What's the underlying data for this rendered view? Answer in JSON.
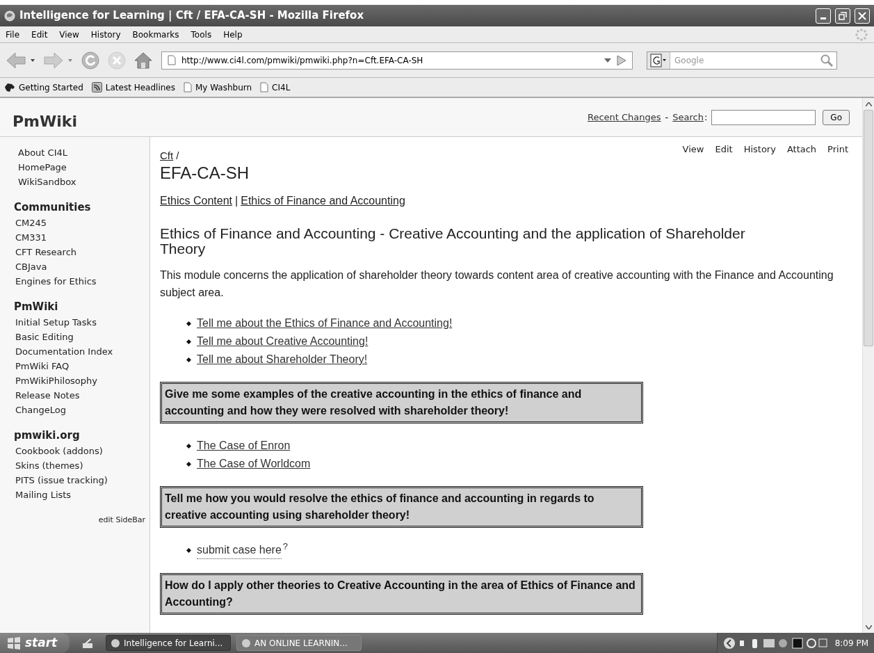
{
  "window": {
    "title": "Intelligence for Learning | Cft / EFA-CA-SH - Mozilla Firefox"
  },
  "menu": [
    "File",
    "Edit",
    "View",
    "History",
    "Bookmarks",
    "Tools",
    "Help"
  ],
  "address": {
    "value": "http://www.ci4l.com/pmwiki/pmwiki.php?n=Cft.EFA-CA-SH"
  },
  "web_search": {
    "placeholder": "Google"
  },
  "bookmarks": [
    {
      "label": "Getting Started",
      "kind": "dog"
    },
    {
      "label": "Latest Headlines",
      "kind": "feed"
    },
    {
      "label": "My Washburn",
      "kind": "page"
    },
    {
      "label": "CI4L",
      "kind": "page"
    }
  ],
  "header": {
    "logo": "PmWiki",
    "links": [
      "Recent Changes",
      "Search"
    ],
    "separator": "-",
    "search_label_suffix": ":",
    "go": "Go"
  },
  "page_actions": [
    "View",
    "Edit",
    "History",
    "Attach",
    "Print"
  ],
  "sidebar": {
    "top": [
      "About CI4L",
      "HomePage",
      "WikiSandbox"
    ],
    "groups": [
      {
        "heading": "Communities",
        "items": [
          "CM245",
          "CM331",
          "CFT Research",
          "CBJava",
          "Engines for Ethics"
        ]
      },
      {
        "heading": "PmWiki",
        "items": [
          "Initial Setup Tasks",
          "Basic Editing",
          "Documentation Index",
          "PmWiki FAQ",
          "PmWikiPhilosophy",
          "Release Notes",
          "ChangeLog"
        ]
      },
      {
        "heading": "pmwiki.org",
        "items": [
          "Cookbook (addons)",
          "Skins (themes)",
          "PITS (issue tracking)",
          "Mailing Lists"
        ]
      }
    ],
    "edit": "edit SideBar"
  },
  "content": {
    "breadcrumb": "Cft",
    "breadcrumb_sep": "/",
    "title": "EFA-CA-SH",
    "trail": [
      "Ethics Content",
      "Ethics of Finance and Accounting"
    ],
    "trail_sep": "|",
    "heading": "Ethics of Finance and Accounting - Creative Accounting and the application of Shareholder Theory",
    "intro": "This module concerns the application of shareholder theory towards content area of creative accounting with the Finance and Accounting subject area.",
    "blocks": [
      {
        "kind": "links",
        "items": [
          "Tell me about the Ethics of Finance and Accounting!",
          "Tell me about Creative Accounting!",
          "Tell me about Shareholder Theory!"
        ]
      },
      {
        "kind": "box",
        "text": "Give me some examples of the creative accounting in the ethics of finance and accounting and how they were resolved with shareholder theory!"
      },
      {
        "kind": "links",
        "items": [
          "The Case of Enron",
          "The Case of Worldcom"
        ]
      },
      {
        "kind": "box",
        "text": "Tell me how you would resolve the ethics of finance and accounting in regards to creative accounting using shareholder theory!"
      },
      {
        "kind": "newlinks",
        "items": [
          "submit case here"
        ],
        "mark": "?"
      },
      {
        "kind": "box",
        "text": "How do I apply other theories to Creative Accounting in the area of Ethics of Finance and Accounting?"
      }
    ]
  },
  "taskbar": {
    "start": "start",
    "tasks": [
      {
        "label": "Intelligence for Learni...",
        "selected": true
      },
      {
        "label": "AN ONLINE LEARNIN...",
        "selected": false
      }
    ],
    "clock": "8:09 PM"
  }
}
